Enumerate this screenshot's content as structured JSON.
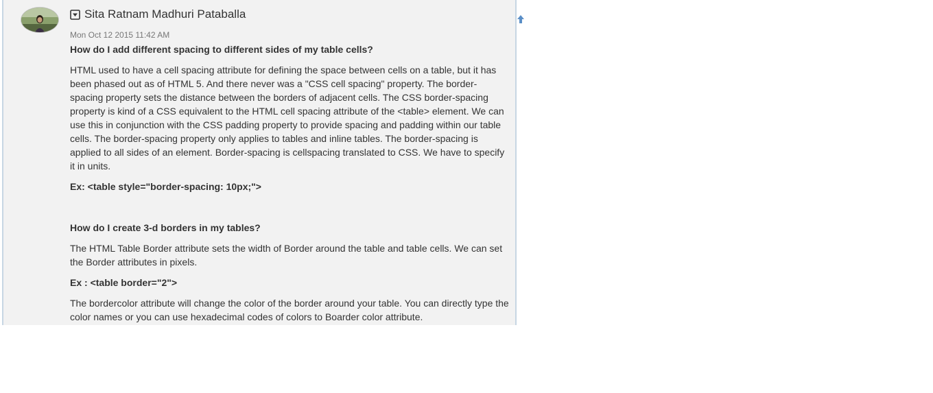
{
  "post": {
    "author": "Sita Ratnam Madhuri Pataballa",
    "timestamp": "Mon Oct 12 2015 11:42 AM",
    "question1": "How do I add different spacing to different sides of my table cells?",
    "answer1": "HTML used to have a cell spacing attribute for defining the space between cells on a table, but it has been phased out as of HTML 5. And there never was a \"CSS cell spacing\" property. The border-spacing property sets the distance between the borders of adjacent cells. The CSS border-spacing property is kind of a CSS equivalent to the HTML cell spacing attribute of the <table> element. We can use this in conjunction with the CSS padding property to provide spacing and padding within our table cells. The border-spacing property only applies to tables and inline tables. The border-spacing is applied to all sides of an element. Border-spacing is cellspacing translated to CSS. We have to specify it in units.",
    "example1": "Ex: <table style=\"border-spacing: 10px;\">",
    "question2": "How do I create 3-d borders in my tables?",
    "answer2": "The HTML Table Border attribute sets the width of Border around the table and table cells. We can set the Border attributes in pixels.",
    "example2": "Ex : <table border=\"2\">",
    "answer3": "The bordercolor attribute will change the color of the border around your table. You can directly type the color names or you can use hexadecimal codes of colors to Boarder color attribute."
  },
  "icons": {
    "toggle": "collapse-toggle-icon",
    "scroll": "arrow-up-icon",
    "accent": "#5b8fc7"
  }
}
